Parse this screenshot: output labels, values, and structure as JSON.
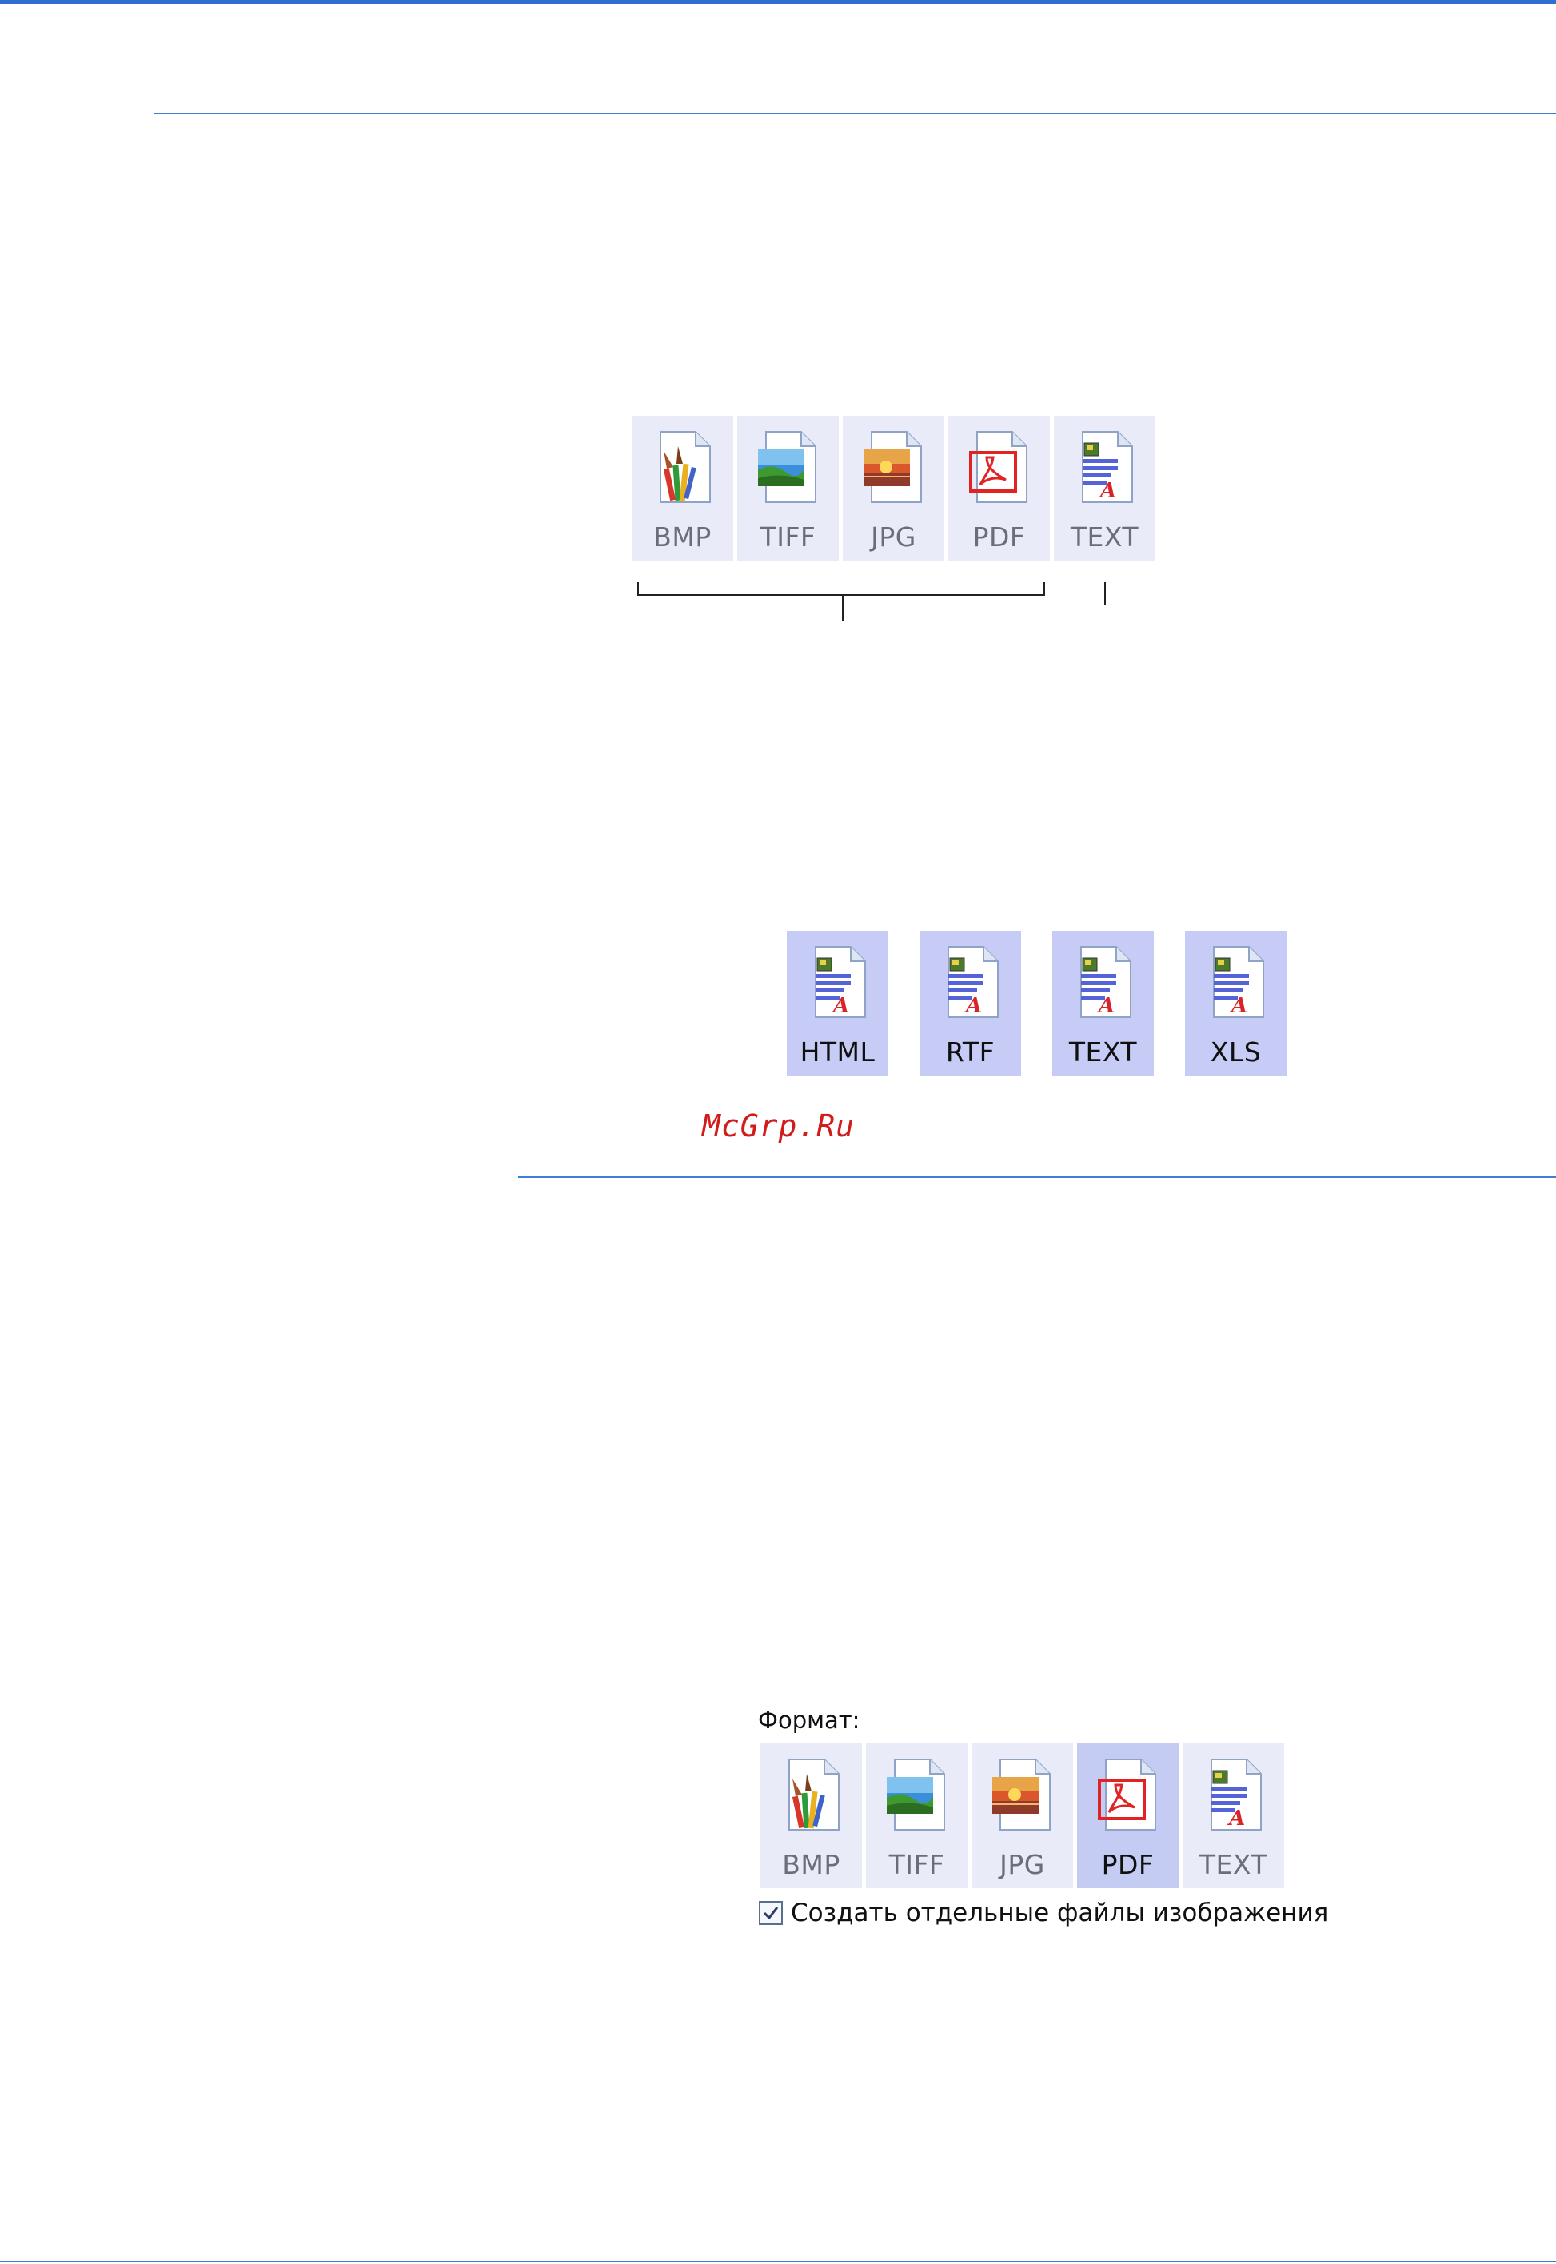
{
  "icons_row_1": [
    {
      "label": "BMP",
      "icon": "bmp-file-icon"
    },
    {
      "label": "TIFF",
      "icon": "tiff-file-icon"
    },
    {
      "label": "JPG",
      "icon": "jpg-file-icon"
    },
    {
      "label": "PDF",
      "icon": "pdf-file-icon"
    },
    {
      "label": "TEXT",
      "icon": "text-file-icon"
    }
  ],
  "icons_row_2": [
    {
      "label": "HTML",
      "icon": "html-file-icon"
    },
    {
      "label": "RTF",
      "icon": "rtf-file-icon"
    },
    {
      "label": "TEXT",
      "icon": "text-file-icon"
    },
    {
      "label": "XLS",
      "icon": "xls-file-icon"
    }
  ],
  "watermark": "McGrp.Ru",
  "format_panel": {
    "label": "Формат:",
    "selected": "PDF",
    "icons": [
      {
        "label": "BMP",
        "icon": "bmp-file-icon"
      },
      {
        "label": "TIFF",
        "icon": "tiff-file-icon"
      },
      {
        "label": "JPG",
        "icon": "jpg-file-icon"
      },
      {
        "label": "PDF",
        "icon": "pdf-file-icon"
      },
      {
        "label": "TEXT",
        "icon": "text-file-icon"
      }
    ],
    "checkbox_label": "Создать отдельные файлы изображения",
    "checkbox_checked": true
  },
  "colors": {
    "accent_line": "#3d7fd6",
    "tile_bg": "#e9ecf8",
    "tile_selected": "#c4ccf4",
    "watermark": "#d21c1c"
  }
}
